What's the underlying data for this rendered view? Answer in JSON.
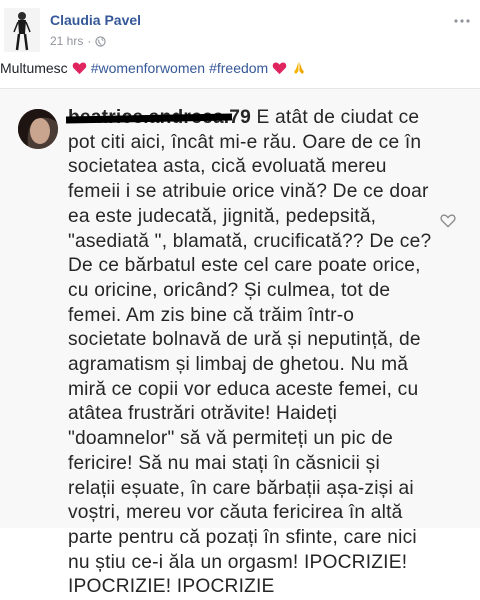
{
  "post": {
    "author": "Claudia Pavel",
    "time": "21 hrs",
    "separator": "·",
    "caption_text": "Multumesc",
    "hashtag1": "#womenforwomen",
    "hashtag2": "#freedom",
    "icons": {
      "heart": "red-heart-icon",
      "pray": "folded-hands-icon",
      "globe": "globe-icon",
      "more": "more-options-icon"
    },
    "colors": {
      "link": "#365899",
      "meta": "#90949c",
      "heart": "#e0245e"
    }
  },
  "comment": {
    "username": "beatrice.andreea.79",
    "lines": [
      "E atât de ciudat ce",
      "pot citi aici, încât mi-e rău.  Oare de ce în",
      "societatea asta, cică evoluată mereu",
      "femeii i se atribuie orice vină? De ce doar",
      "ea este judecată, jignită, pedepsită,",
      "\"asediată \", blamată, crucificată?? De ce?",
      "De ce bărbatul este cel care poate orice,",
      "cu oricine, oricând? Și culmea, tot de",
      "femei. Am zis bine că trăim într-o",
      "societate bolnavă de ură și neputință, de",
      "agramatism și limbaj de ghetou. Nu mă",
      "miră ce copii vor educa aceste femei, cu",
      "atâtea frustrări otrăvite! Haideți",
      "\"doamnelor\" să vă permiteți un pic de",
      "fericire! Să nu mai stați în căsnicii și",
      "relații eșuate, în care bărbații așa-ziși ai",
      "voștri, mereu vor căuta fericirea în altă",
      "parte pentru că pozați în sfinte, care nici",
      "nu știu ce-i ăla un orgasm! IPOCRIZIE!",
      "IPOCRIZIE! IPOCRIZIE"
    ],
    "icons": {
      "like": "heart-outline-icon"
    }
  }
}
